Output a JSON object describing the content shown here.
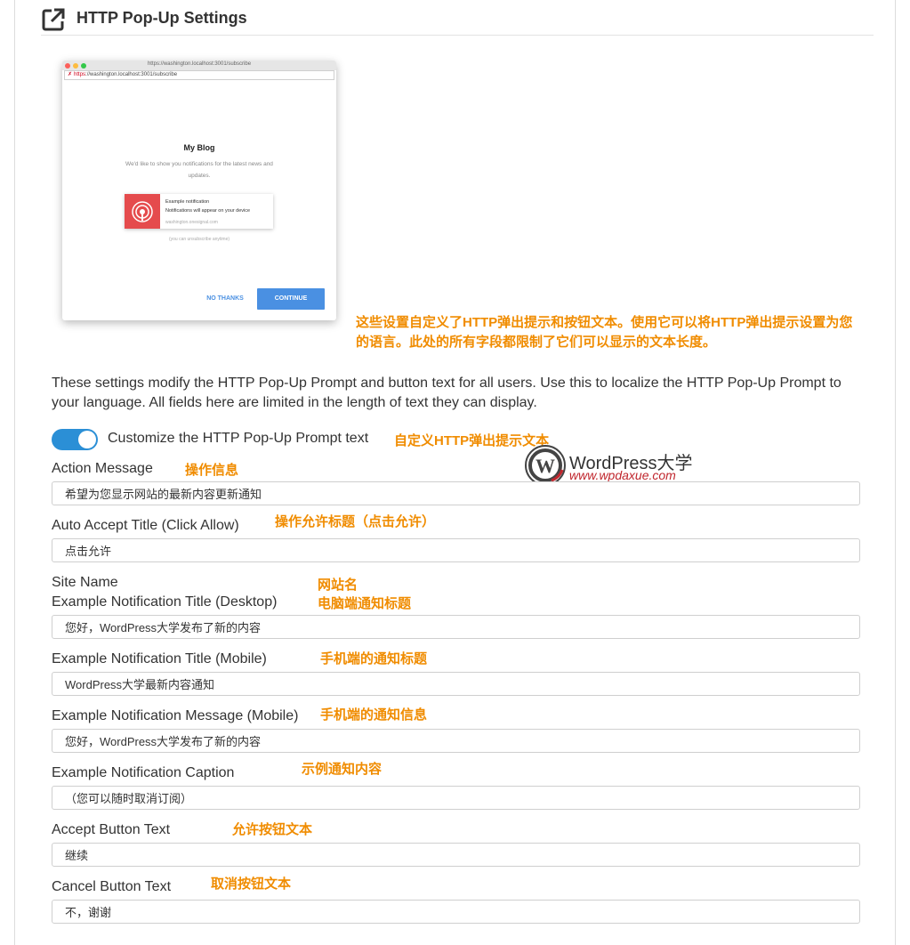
{
  "header": {
    "title": "HTTP Pop-Up Settings",
    "icon": "external-link-icon"
  },
  "preview": {
    "chrome_url": "https://washington.localhost:3001/subscribe",
    "address_scheme": "https",
    "address_rest": "://washington.localhost:3001/subscribe",
    "site_name": "My Blog",
    "message": "We'd like to show you notifications for the latest news and updates.",
    "notification_title": "Example notification",
    "notification_message": "Notifications will appear on your device",
    "notification_site": "washington.onesignal.com",
    "unsubscribe": "(you can unsubscribe anytime)",
    "cancel_label": "NO THANKS",
    "accept_label": "CONTINUE",
    "accent": "#4a90e2",
    "icon_bg": "#e54b4d"
  },
  "annotations": {
    "intro": "这些设置自定义了HTTP弹出提示和按钮文本。使用它可以将HTTP弹出提示设置为您的语言。此处的所有字段都限制了它们可以显示的文本长度。",
    "toggle": "自定义HTTP弹出提示文本",
    "action_message": "操作信息",
    "auto_accept": "操作允许标题（点击允许）",
    "site_name": "网站名",
    "desktop_title": "电脑端通知标题",
    "mobile_title": "手机端的通知标题",
    "mobile_message": "手机端的通知信息",
    "caption": "示例通知内容",
    "accept_button": "允许按钮文本",
    "cancel_button": "取消按钮文本",
    "color": "#f08c00"
  },
  "description": "These settings modify the HTTP Pop-Up Prompt and button text for all users. Use this to localize the HTTP Pop-Up Prompt to your language. All fields here are limited in the length of text they can display.",
  "toggle": {
    "label": "Customize the HTTP Pop-Up Prompt text",
    "on": true,
    "color": "#2b8fd6"
  },
  "fields": {
    "action_message": {
      "label": "Action Message",
      "value": "希望为您显示网站的最新内容更新通知"
    },
    "auto_accept_title": {
      "label": "Auto Accept Title (Click Allow)",
      "value": "点击允许"
    },
    "site_name": {
      "label": "Site Name"
    },
    "desktop_title": {
      "label": "Example Notification Title (Desktop)",
      "value": "您好，WordPress大学发布了新的内容"
    },
    "mobile_title": {
      "label": "Example Notification Title (Mobile)",
      "value": "WordPress大学最新内容通知"
    },
    "mobile_message": {
      "label": "Example Notification Message (Mobile)",
      "value": "您好，WordPress大学发布了新的内容"
    },
    "caption": {
      "label": "Example Notification Caption",
      "value": "（您可以随时取消订阅）"
    },
    "accept_button": {
      "label": "Accept Button Text",
      "value": "继续"
    },
    "cancel_button": {
      "label": "Cancel Button Text",
      "value": "不，谢谢"
    }
  },
  "watermark": {
    "name": "WordPress大学",
    "url": "www.wpdaxue.com"
  }
}
